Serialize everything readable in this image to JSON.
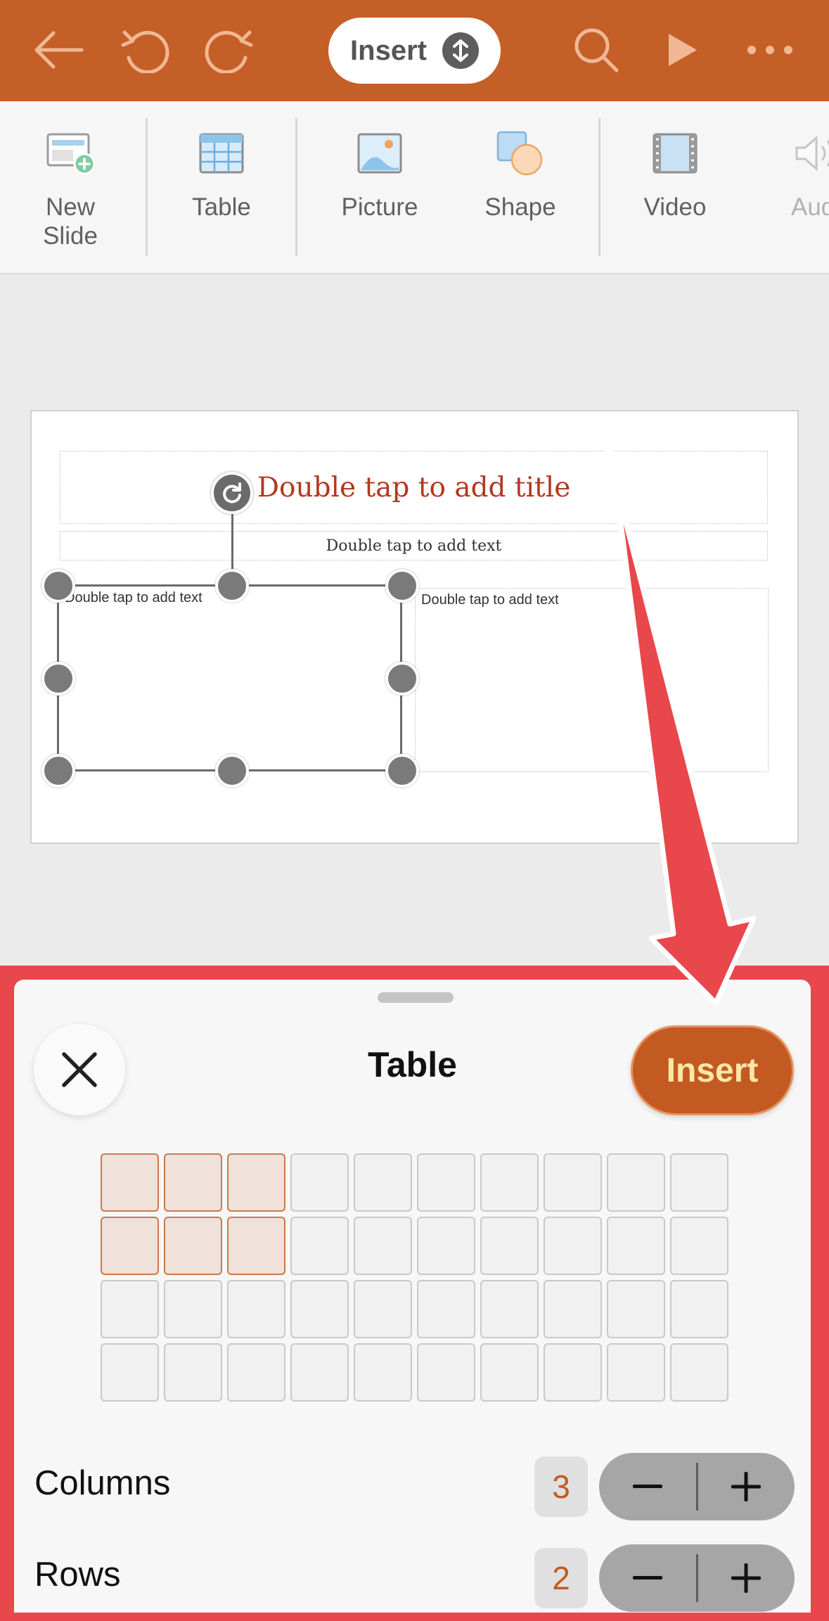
{
  "toolbar": {
    "back_icon": "arrow-left-icon",
    "undo_icon": "undo-icon",
    "redo_icon": "redo-icon",
    "mode_label": "Insert",
    "mode_icon": "up-down-chevron-icon",
    "search_icon": "search-icon",
    "play_icon": "play-icon",
    "more_icon": "ellipsis-icon",
    "bar_color": "#c55f28"
  },
  "ribbon": {
    "items": [
      {
        "label": "New\nSlide",
        "icon": "new-slide-icon"
      },
      {
        "label": "Table",
        "icon": "table-icon"
      },
      {
        "label": "Picture",
        "icon": "picture-icon"
      },
      {
        "label": "Shape",
        "icon": "shape-icon"
      },
      {
        "label": "Video",
        "icon": "video-icon"
      },
      {
        "label": "Audi",
        "icon": "audio-icon"
      }
    ]
  },
  "slide": {
    "title_placeholder": "Double tap to add title",
    "subtitle_placeholder": "Double tap to add text",
    "left_placeholder": "Double tap to add text",
    "right_placeholder": "Double tap to add text"
  },
  "sheet": {
    "title": "Table",
    "insert_label": "Insert",
    "close_icon": "close-icon",
    "grid_columns": 10,
    "grid_rows": 4,
    "selected_columns": 3,
    "selected_rows": 2,
    "columns_label": "Columns",
    "columns_value": "3",
    "rows_label": "Rows",
    "rows_value": "2",
    "minus_icon": "minus-icon",
    "plus_icon": "plus-icon",
    "accent_color": "#c35a21",
    "highlight_color": "#e8474b"
  }
}
